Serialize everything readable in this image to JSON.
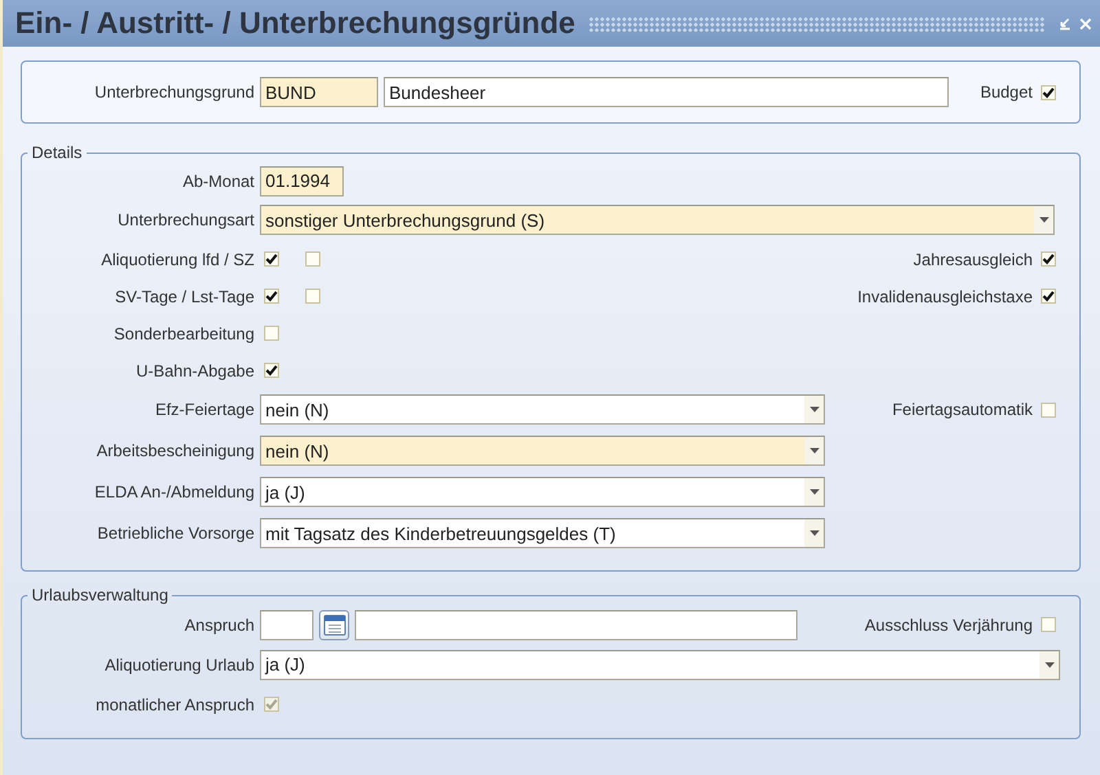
{
  "window": {
    "title": "Ein- / Austritt- / Unterbrechungsgründe"
  },
  "header": {
    "label": "Unterbrechungsgrund",
    "code": {
      "value": "BUND",
      "highlighted": true
    },
    "name": {
      "value": "Bundesheer",
      "highlighted": false
    },
    "side": {
      "label": "Budget",
      "checked": true,
      "disabled": false
    }
  },
  "details": {
    "legend": "Details",
    "rows": [
      {
        "kind": "text",
        "label": "Ab-Monat",
        "value": "01.1994",
        "highlighted": true
      },
      {
        "kind": "wide_select",
        "label": "Unterbrechungsart",
        "value": "sonstiger Unterbrechungsgrund (S)",
        "highlighted": true
      },
      {
        "kind": "checks",
        "label": "Aliquotierung lfd / SZ",
        "checks": [
          {
            "checked": true,
            "disabled": false
          },
          {
            "checked": false,
            "disabled": false
          }
        ],
        "side": {
          "label": "Jahresausgleich",
          "checked": true,
          "disabled": false
        }
      },
      {
        "kind": "checks",
        "label": "SV-Tage / Lst-Tage",
        "checks": [
          {
            "checked": true,
            "disabled": false
          },
          {
            "checked": false,
            "disabled": false
          }
        ],
        "side": {
          "label": "Invalidenausgleichstaxe",
          "checked": true,
          "disabled": false
        }
      },
      {
        "kind": "checks",
        "label": "Sonderbearbeitung",
        "checks": [
          {
            "checked": false,
            "disabled": false
          }
        ]
      },
      {
        "kind": "checks",
        "label": "U-Bahn-Abgabe",
        "checks": [
          {
            "checked": true,
            "disabled": false
          }
        ]
      },
      {
        "kind": "select",
        "label": "Efz-Feiertage",
        "value": "nein (N)",
        "highlighted": false,
        "side": {
          "label": "Feiertagsautomatik",
          "checked": false,
          "disabled": false
        }
      },
      {
        "kind": "select",
        "label": "Arbeitsbescheinigung",
        "value": "nein (N)",
        "highlighted": true
      },
      {
        "kind": "select",
        "label": "ELDA An-/Abmeldung",
        "value": "ja (J)",
        "highlighted": false
      },
      {
        "kind": "select",
        "label": "Betriebliche Vorsorge",
        "value": "mit Tagsatz des Kinderbetreuungsgeldes (T)",
        "highlighted": false
      }
    ]
  },
  "vacation": {
    "legend": "Urlaubsverwaltung",
    "rows": [
      {
        "kind": "date",
        "label": "Anspruch",
        "value_1": "",
        "value_2": "",
        "side": {
          "label": "Ausschluss Verjährung",
          "checked": false,
          "disabled": false
        }
      },
      {
        "kind": "wide_select",
        "label": "Aliquotierung Urlaub",
        "value": "ja (J)",
        "highlighted": false
      },
      {
        "kind": "checks",
        "label": "monatlicher Anspruch",
        "checks": [
          {
            "checked": true,
            "disabled": true
          }
        ]
      }
    ]
  }
}
